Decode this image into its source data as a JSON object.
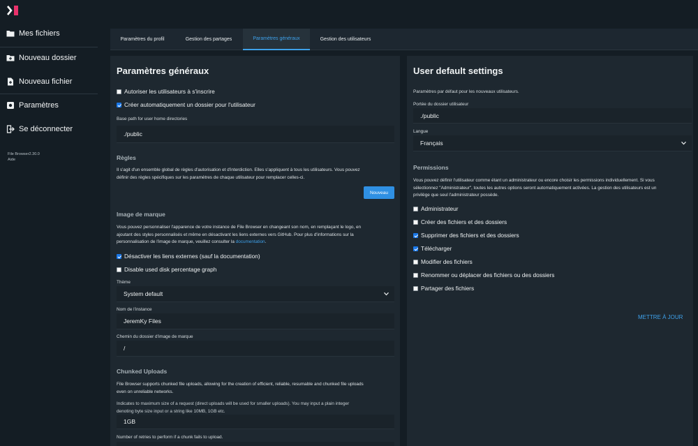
{
  "sidebar": {
    "items": [
      {
        "label": "Mes fichiers",
        "icon": "folder-icon"
      },
      {
        "label": "Nouveau dossier",
        "icon": "new-folder-icon"
      },
      {
        "label": "Nouveau fichier",
        "icon": "new-file-icon"
      },
      {
        "label": "Paramètres",
        "icon": "settings-icon"
      },
      {
        "label": "Se déconnecter",
        "icon": "logout-icon"
      }
    ],
    "version": "File Browser2.30.0",
    "help": "Aide"
  },
  "tabs": [
    {
      "label": "Paramètres du profil"
    },
    {
      "label": "Gestion des partages"
    },
    {
      "label": "Paramètres généraux"
    },
    {
      "label": "Gestion des utilisateurs"
    }
  ],
  "general": {
    "title": "Paramètres généraux",
    "allow_signup": "Autoriser les utilisateurs à s'inscrire",
    "auto_folder": "Créer automatiquement un dossier pour l'utilisateur",
    "base_path_label": "Base path for user home directories",
    "base_path_value": "./public",
    "rules_title": "Règles",
    "rules_text_1": "Il s'agit d'un ensemble global de règles d'autorisation et d'interdiction. Elles s'appliquent à tous les utilisateurs. Vous pouvez",
    "rules_text_2": "définir des règles spécifiques sur les paramètres de chaque utilisateur pour remplacer celles-ci.",
    "new_button": "Nouveau",
    "branding_title": "Image de marque",
    "branding_text_1": "Vous pouvez personnaliser l'apparence de votre instance de File Browser en changeant son nom, en remplaçant le logo, en",
    "branding_text_2": "ajoutant des styles personnalisés et même en désactivant les liens externes vers GitHub. Pour plus d'informations sur la",
    "branding_text_3": "personnalisation de l'image de marque, veuillez consulter la ",
    "branding_link": "documentation",
    "branding_text_4": ".",
    "disable_external": "Désactiver les liens externes (sauf la documentation)",
    "disable_disk": "Disable used disk percentage graph",
    "theme_label": "Thème",
    "theme_value": "System default",
    "instance_label": "Nom de l'instance",
    "instance_value": "JeremKy Files",
    "branding_dir_label": "Chemin du dossier d'image de marque",
    "branding_dir_value": "/",
    "chunked_title": "Chunked Uploads",
    "chunked_text_1": "File Browser supports chunked file uploads, allowing for the creation of efficient, reliable, resumable and chunked file uploads",
    "chunked_text_2": "even on unreliable networks.",
    "max_size_label_1": "Indicates to maximum size of a request (direct uploads will be used for smaller uploads). You may input a plain integer",
    "max_size_label_2": "denoting byte size input or a string like 10MB, 1GB etc.",
    "max_size_value": "1GB",
    "retries_label": "Number of retries to perform if a chunk fails to upload."
  },
  "user_defaults": {
    "title": "User default settings",
    "description": "Paramètres par défaut pour les nouveaux utilisateurs.",
    "scope_label": "Portée du dossier utilisateur",
    "scope_value": "./public",
    "language_label": "Langue",
    "language_value": "Français",
    "permissions_title": "Permissions",
    "permissions_text_1": "Vous pouvez définir l'utilisateur comme étant un administrateur ou encore choisir les permissions individuellement. Si vous",
    "permissions_text_2": "sélectionnez \"Administrateur\", toutes les autres options seront automatiquement activées. La gestion des utilisateurs est un",
    "permissions_text_3": "privilège que seul l'administrateur possède.",
    "permissions": [
      {
        "label": "Administrateur"
      },
      {
        "label": "Créer des fichiers et des dossiers"
      },
      {
        "label": "Supprimer des fichiers et des dossiers"
      },
      {
        "label": "Télécharger"
      },
      {
        "label": "Modifier des fichiers"
      },
      {
        "label": "Renommer ou déplacer des fichiers ou des dossiers"
      },
      {
        "label": "Partager des fichiers"
      }
    ],
    "update_button": "METTRE À JOUR"
  }
}
